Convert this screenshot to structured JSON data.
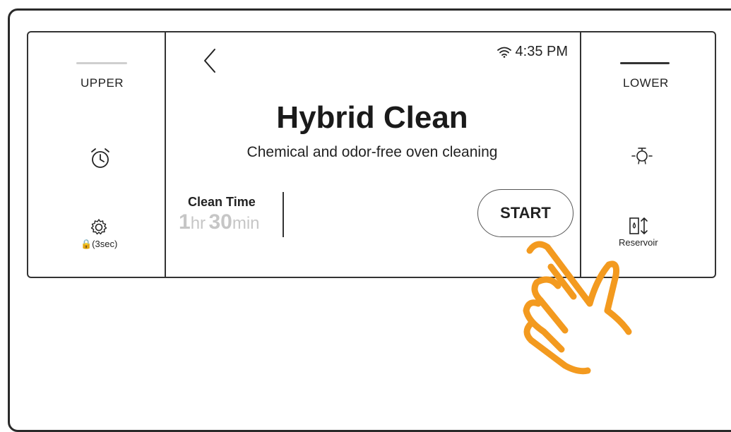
{
  "left_panel": {
    "label": "UPPER",
    "lock_text": "🔒(3sec)"
  },
  "right_panel": {
    "label": "LOWER",
    "reservoir_text": "Reservoir"
  },
  "status": {
    "time": "4:35 PM"
  },
  "main": {
    "title": "Hybrid Clean",
    "subtitle": "Chemical and odor-free oven cleaning",
    "clean_time_label": "Clean Time",
    "hours": "1",
    "hours_unit": "hr",
    "minutes": "30",
    "minutes_unit": "min",
    "start_label": "START"
  },
  "colors": {
    "hand": "#F39A1F",
    "inactive_bar": "#cfcfcf",
    "active_bar": "#333333",
    "dim_text": "#c6c6c6"
  },
  "icons": [
    "back-arrow-icon",
    "wifi-icon",
    "timer-icon",
    "settings-gear-icon",
    "lock-icon",
    "light-bulb-icon",
    "reservoir-icon",
    "pointing-hand-icon"
  ]
}
